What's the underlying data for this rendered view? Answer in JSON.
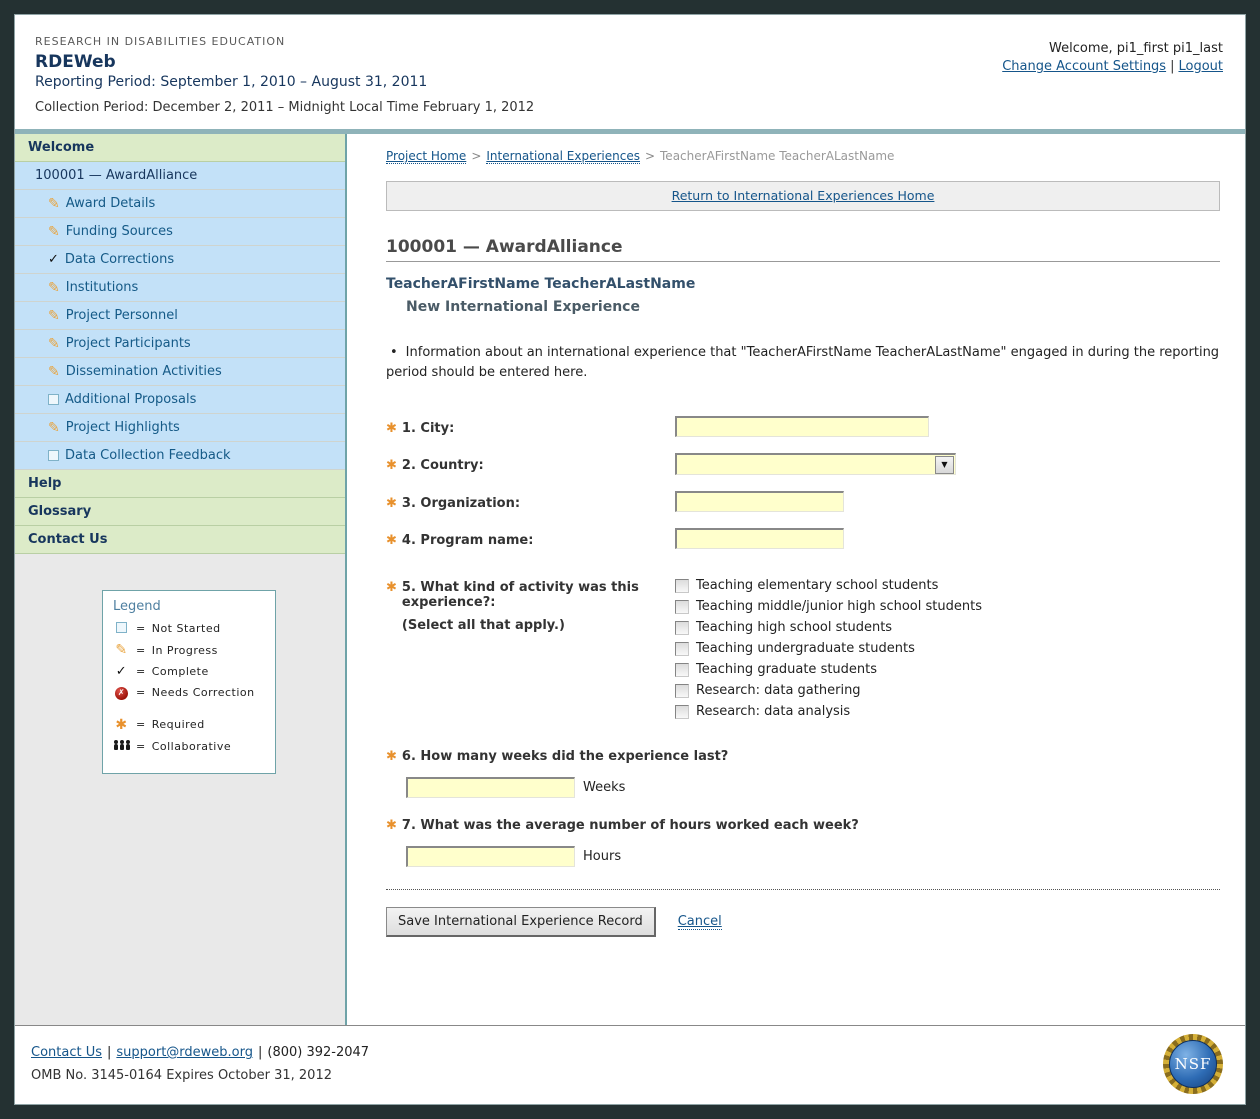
{
  "colors": {
    "frame": "#243132",
    "teal_band": "#8fb3b9",
    "sidebar_green": "#dcebc8",
    "sidebar_blue": "#c3e1f8",
    "input_yellow": "#ffffcc",
    "required_orange": "#e8912d",
    "link_blue": "#15558a",
    "heading_navy": "#17365d"
  },
  "icons": {
    "pencil": "✎",
    "check": "✓",
    "error_x": "✗",
    "star": "✱",
    "dropdown_arrow": "▼",
    "bullet": "•"
  },
  "header": {
    "eyebrow": "RESEARCH IN DISABILITIES EDUCATION",
    "app_title": "RDEWeb",
    "reporting_period": "Reporting Period: September 1, 2010 – August 31, 2011",
    "collection_period": "Collection Period: December 2, 2011 – Midnight Local Time February 1, 2012",
    "welcome": "Welcome, pi1_first pi1_last",
    "change_account": "Change Account Settings",
    "sep": "|",
    "logout": "Logout"
  },
  "sidebar": {
    "welcome": "Welcome",
    "award": "100001 — AwardAlliance",
    "items": [
      {
        "icon": "pencil",
        "label": "Award Details"
      },
      {
        "icon": "pencil",
        "label": "Funding Sources"
      },
      {
        "icon": "check",
        "label": "Data Corrections"
      },
      {
        "icon": "pencil",
        "label": "Institutions"
      },
      {
        "icon": "pencil",
        "label": "Project Personnel"
      },
      {
        "icon": "pencil",
        "label": "Project Participants"
      },
      {
        "icon": "pencil",
        "label": "Dissemination Activities"
      },
      {
        "icon": "square",
        "label": "Additional Proposals"
      },
      {
        "icon": "pencil",
        "label": "Project Highlights"
      },
      {
        "icon": "square",
        "label": "Data Collection Feedback"
      }
    ],
    "help": "Help",
    "glossary": "Glossary",
    "contact_us": "Contact Us"
  },
  "legend": {
    "title": "Legend",
    "eq": "=",
    "items": [
      {
        "icon": "square",
        "label": "Not Started"
      },
      {
        "icon": "pencil",
        "label": "In Progress"
      },
      {
        "icon": "check",
        "label": "Complete"
      },
      {
        "icon": "error",
        "label": "Needs Correction"
      },
      {
        "icon": "star",
        "label": "Required"
      },
      {
        "icon": "people",
        "label": "Collaborative"
      }
    ]
  },
  "breadcrumb": {
    "project_home": "Project Home",
    "sep": ">",
    "international_experiences": "International Experiences",
    "current": "TeacherAFirstName TeacherALastName"
  },
  "main": {
    "return_link": "Return to International Experiences Home",
    "award_title": "100001 — AwardAlliance",
    "teacher_name": "TeacherAFirstName TeacherALastName",
    "subtitle": "New International Experience",
    "info_bullet": "Information about an international experience that \"TeacherAFirstName TeacherALastName\" engaged in during the reporting period should be entered here.",
    "form": {
      "q1_label": "1. City:",
      "q2_label": "2. Country:",
      "q3_label": "3. Organization:",
      "q4_label": "4. Program name:",
      "q5_label": "5. What kind of activity was this experience?:",
      "q5_hint": "(Select all that apply.)",
      "q5_options": [
        "Teaching elementary school students",
        "Teaching middle/junior high school students",
        "Teaching high school students",
        "Teaching undergraduate students",
        "Teaching graduate students",
        "Research: data gathering",
        "Research: data analysis"
      ],
      "q6_label": "6. How many weeks did the experience last?",
      "q6_unit": "Weeks",
      "q7_label": "7. What was the average number of hours worked each week?",
      "q7_unit": "Hours",
      "save_label": "Save International Experience Record",
      "cancel_label": "Cancel"
    }
  },
  "footer": {
    "contact_us": "Contact Us",
    "sep": "|",
    "email": "support@rdeweb.org",
    "phone": "(800) 392-2047",
    "omb": "OMB No. 3145-0164 Expires October 31, 2012",
    "nsf": "NSF"
  }
}
